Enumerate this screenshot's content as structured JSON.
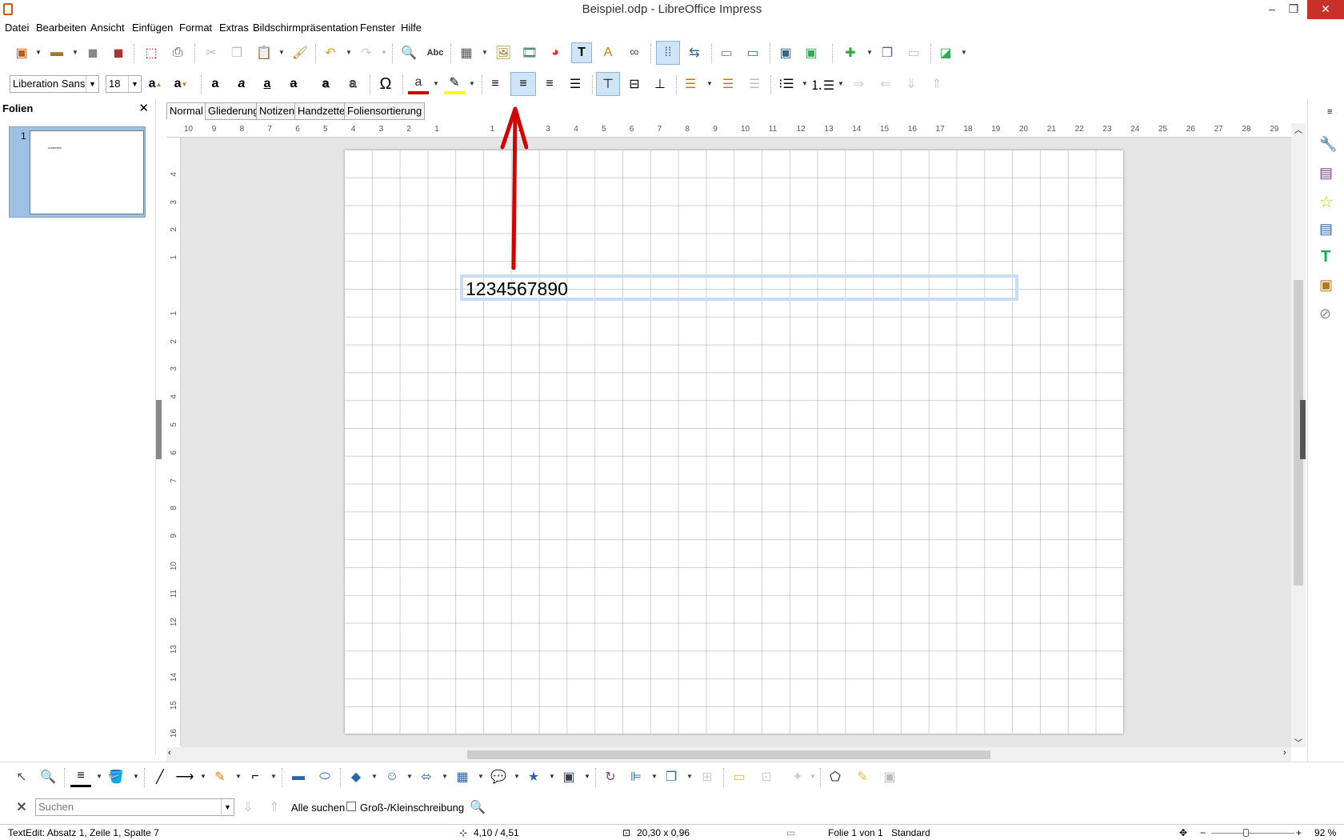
{
  "window": {
    "title": "Beispiel.odp - LibreOffice Impress",
    "minimize": "–",
    "maximize": "❐",
    "close": "✕"
  },
  "menu": [
    "Datei",
    "Bearbeiten",
    "Ansicht",
    "Einfügen",
    "Format",
    "Extras",
    "Bildschirmpräsentation",
    "Fenster",
    "Hilfe"
  ],
  "format_bar": {
    "font_name": "Liberation Sans",
    "font_size": "18"
  },
  "slides_pane": {
    "title": "Folien",
    "close": "✕",
    "slide_number": "1",
    "thumb_text": "1234567890"
  },
  "view_tabs": [
    "Normal",
    "Gliederung",
    "Notizen",
    "Handzettel",
    "Foliensortierung"
  ],
  "slide": {
    "text": "1234567890"
  },
  "hruler_labels": [
    "10",
    "9",
    "8",
    "7",
    "6",
    "5",
    "4",
    "3",
    "2",
    "1",
    "",
    "1",
    "2",
    "3",
    "4",
    "5",
    "6",
    "7",
    "8",
    "9",
    "10",
    "11",
    "12",
    "13",
    "14",
    "15",
    "16",
    "17",
    "18",
    "19",
    "20",
    "21",
    "22",
    "23",
    "24",
    "25",
    "26",
    "27",
    "28",
    "29"
  ],
  "vruler_labels": [
    "4",
    "3",
    "2",
    "1",
    "",
    "1",
    "2",
    "3",
    "4",
    "5",
    "6",
    "7",
    "8",
    "9",
    "10",
    "11",
    "12",
    "13",
    "14",
    "15",
    "16"
  ],
  "find_bar": {
    "placeholder": "Suchen",
    "find_all": "Alle suchen",
    "match_case": "Groß-/Kleinschreibung"
  },
  "status_bar": {
    "edit_info": "TextEdit: Absatz 1, Zeile 1, Spalte 7",
    "position": "4,10 / 4,51",
    "size": "20,30 x 0,96",
    "slide_info": "Folie 1 von 1",
    "layout": "Standard",
    "zoom": "92 %"
  },
  "colors": {
    "accent": "#c6ddf3",
    "arrow": "#d40000",
    "close_button": "#c7312a"
  }
}
